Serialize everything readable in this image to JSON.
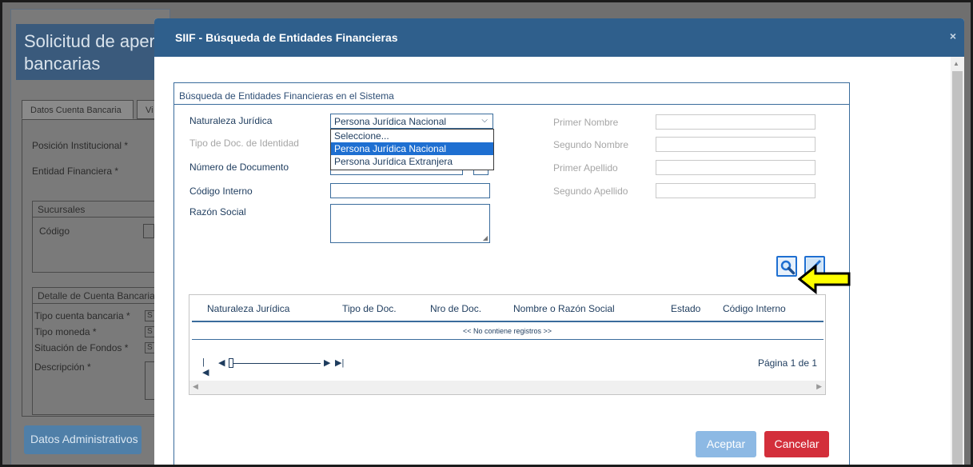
{
  "background": {
    "page_title": "Solicitud de aper bancarias",
    "page_title_line1": "Solicitud de aper",
    "page_title_line2": "bancarias",
    "tabs": [
      "Datos Cuenta Bancaria",
      "Vi"
    ],
    "fields": {
      "posicion": "Posición Institucional *",
      "entidad": "Entidad Financiera *"
    },
    "sucursales": {
      "title": "Sucursales",
      "codigo": "Código"
    },
    "detalle": {
      "title": "Detalle de Cuenta Bancaria",
      "tipo_cuenta": "Tipo cuenta bancaria  *",
      "tipo_moneda": "Tipo moneda *",
      "situacion": "Situación de Fondos *",
      "descripcion": "Descripción  *",
      "select_marker": "S"
    },
    "admin_button": "Datos Administrativos"
  },
  "modal": {
    "title": "SIIF - Búsqueda de Entidades Financieras",
    "close": "×",
    "legend": "Búsqueda de Entidades Financieras en el Sistema",
    "labels": {
      "naturaleza": "Naturaleza Jurídica",
      "tipo_doc": "Tipo de Doc. de Identidad",
      "numero_doc": "Número de Documento",
      "codigo_interno": "Código Interno",
      "razon_social": "Razón Social",
      "primer_nombre": "Primer Nombre",
      "segundo_nombre": "Segundo Nombre",
      "primer_apellido": "Primer Apellido",
      "segundo_apellido": "Segundo Apellido"
    },
    "naturaleza_selected": "Persona Jurídica Nacional",
    "naturaleza_options": [
      "Seleccione...",
      "Persona Jurídica Nacional",
      "Persona Jurídica Extranjera"
    ],
    "results": {
      "columns": [
        "Naturaleza Jurídica",
        "Tipo de Doc.",
        "Nro de Doc.",
        "Nombre o Razón Social",
        "Estado",
        "Código Interno"
      ],
      "empty": "<< No contiene registros >>",
      "page_info": "Página 1 de 1"
    },
    "buttons": {
      "accept": "Aceptar",
      "cancel": "Cancelar"
    }
  },
  "icons": [
    "search-icon",
    "clear-icon",
    "arrow-pointer-icon",
    "first-page-icon",
    "prev-page-icon",
    "next-page-icon",
    "last-page-icon"
  ],
  "colors": {
    "header": "#2f5f8c",
    "accent": "#1e6fd1",
    "cancel": "#d32f3b",
    "accept": "#8db9e4",
    "arrow": "#ffff00"
  }
}
